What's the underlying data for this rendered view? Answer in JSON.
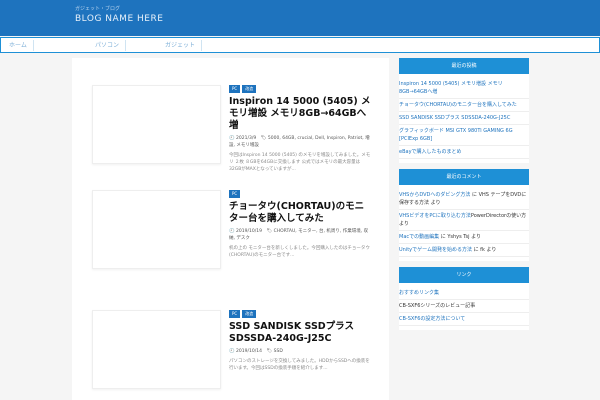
{
  "header": {
    "tagline": "ガジェット・ブログ",
    "site_title": "BLOG NAME HERE"
  },
  "nav": {
    "items": [
      "ホーム",
      "パソコン",
      "ガジェット"
    ]
  },
  "posts": [
    {
      "badges": [
        "PC",
        "改造"
      ],
      "title": "Inspiron 14 5000 (5405) メモリ増設 メモリ8GB→64GBへ増",
      "meta": "🕘 2021/3/9　🏷 5000, 64GB, crucial, Dell, Inspiron, Patriot, 増設, メモリ増設",
      "excerpt": "今回はInspiron 14 5000 (5405) のメモリを増設してみました。メモリ ２枚 ８GBを64GBに交換します 公式ではメモリの最大容量は32GBがMAXとなっていますが..."
    },
    {
      "badges": [
        "PC"
      ],
      "title": "チョータウ(CHORTAU)のモニター台を購入してみた",
      "meta": "🕘 2019/10/19　🏷 CHORTAU, モニター, 台, 机周り, 作業環境, 収納, デスク",
      "excerpt": "机の上の モニター台を新しくしました。今回購入したのはチョータウ(CHORTAU)のモニター台です..."
    },
    {
      "badges": [
        "PC",
        "改造"
      ],
      "title": "SSD SANDISK SSDプラス SDSSDA-240G-J25C",
      "meta": "🕘 2019/10/14　🏷 SSD",
      "excerpt": "パソコンのストレージを交換してみました。HDDからSSDへの換装を行います。今回はSSDの換装手順を紹介します..."
    }
  ],
  "sidebar": {
    "recent_title": "最近の投稿",
    "recent_posts": [
      "Inspiron 14 5000 (5405) メモリ増設 メモリ8GB→64GBへ増",
      "チョータウ(CHORTAU)のモニター台を購入してみた",
      "SSD SANDISK SSDプラス SDSSDA-240G-J25C",
      "グラフィックボード MSI GTX 980Ti GAMING 6G [PCIExp 6GB]",
      "eBayで購入したものまとめ"
    ],
    "comments_title": "最近のコメント",
    "comments": [
      {
        "link": "VHSからDVDへのダビング方法",
        "text": " に VHS テープをDVDに保存する方法 より"
      },
      {
        "link": "VHSビデオをPCに取り込む方法",
        "text": "PowerDirectorの使い方 より"
      },
      {
        "link": "Macでの動画編集",
        "text": " に Yshys Tsj より"
      },
      {
        "link": "Unityでゲーム開発を始める方法",
        "text": " に fk より"
      }
    ],
    "links_title": "リンク",
    "links": [
      "おすすめリンク集",
      "CB-SXF6シリーズのレビュー記事",
      "CB-SXF6の設定方法について"
    ]
  }
}
